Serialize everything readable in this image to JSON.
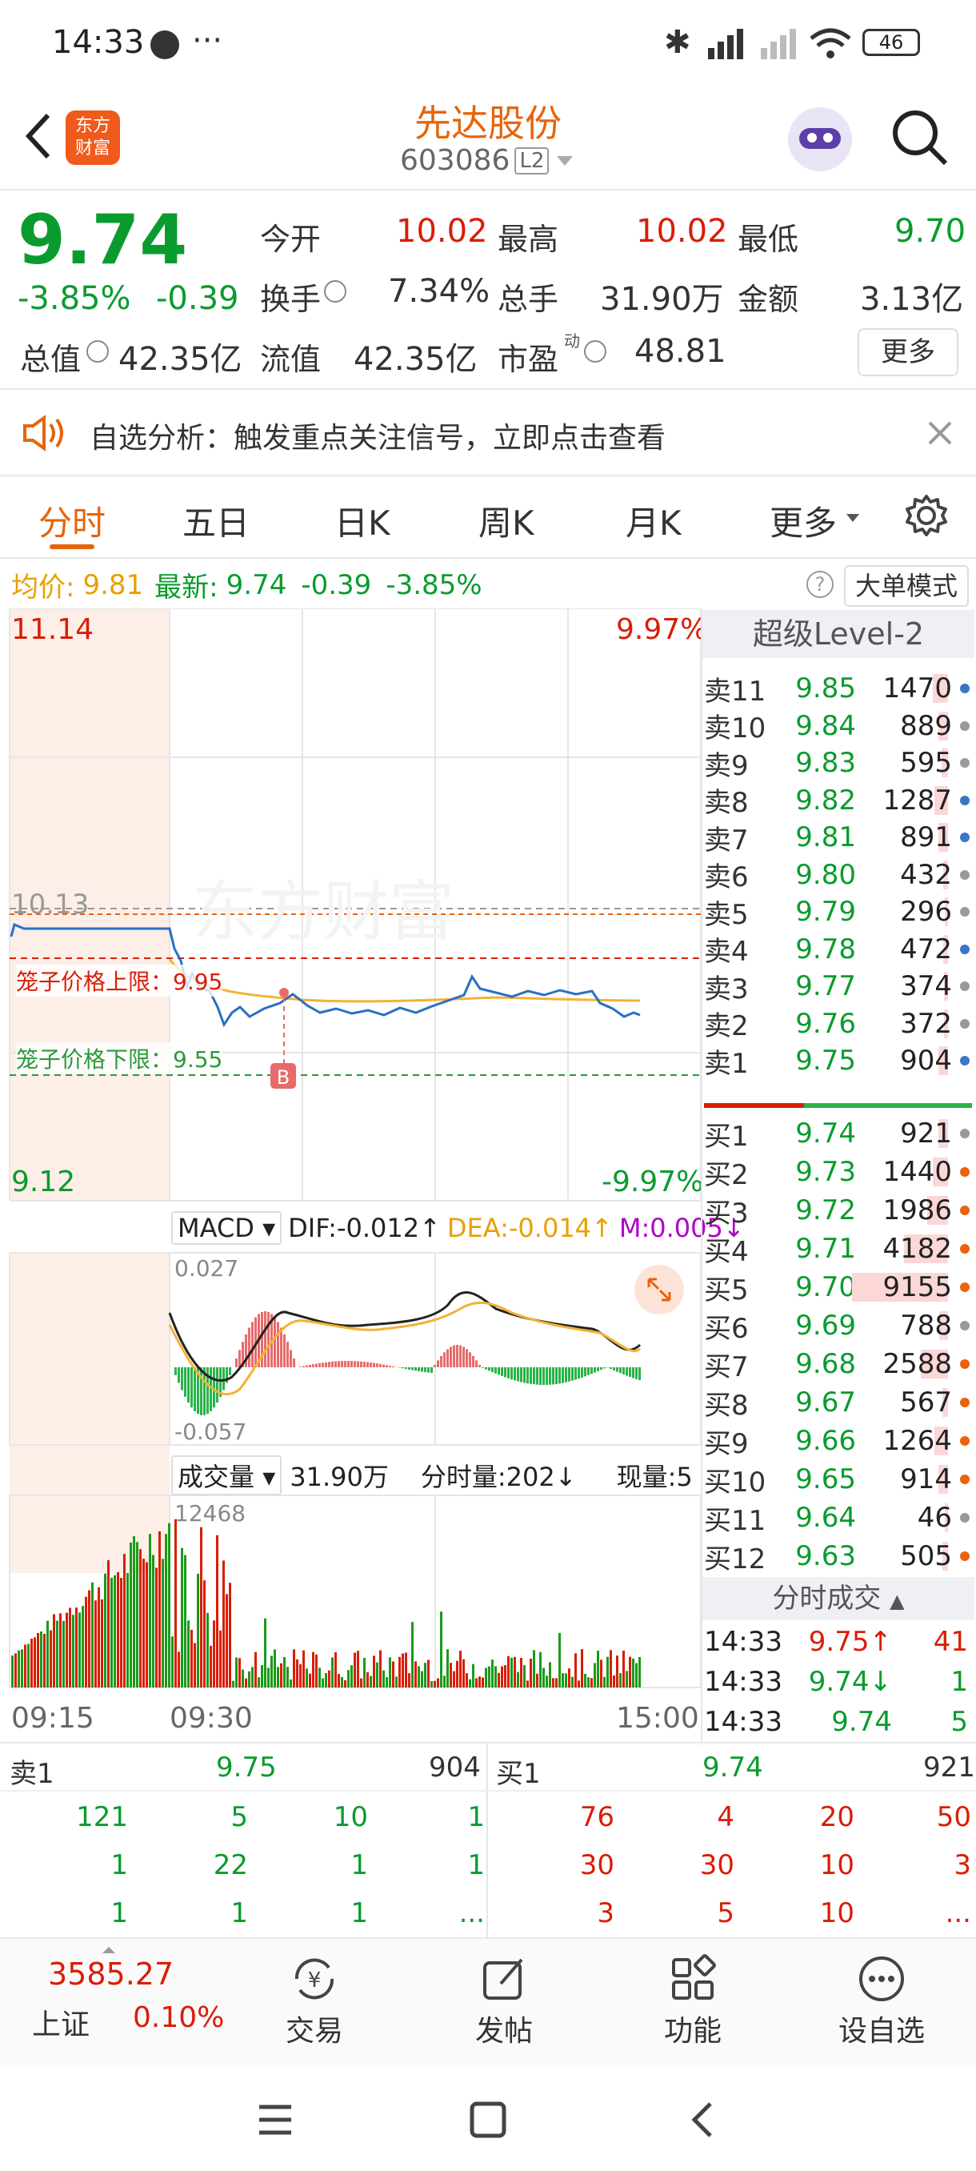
{
  "status_bar": {
    "time": "14:33",
    "more": "···",
    "battery": "46"
  },
  "header": {
    "stock_name": "先达股份",
    "stock_code": "603086",
    "level_badge": "L2",
    "logo_text": "东方财富"
  },
  "quote": {
    "price": "9.74",
    "change_pct": "-3.85%",
    "change": "-0.39",
    "open_label": "今开",
    "open": "10.02",
    "high_label": "最高",
    "high": "10.02",
    "low_label": "最低",
    "low": "9.70",
    "turnover_label": "换手",
    "turnover": "7.34%",
    "volume_label": "总手",
    "volume": "31.90万",
    "amount_label": "金额",
    "amount": "3.13亿",
    "mktcap_label": "总值",
    "mktcap": "42.35亿",
    "float_label": "流值",
    "float_cap": "42.35亿",
    "pe_label": "市盈",
    "pe_sup": "动",
    "pe": "48.81",
    "more_button": "更多"
  },
  "notice": {
    "text": "自选分析：触发重点关注信号，立即点击查看"
  },
  "chart_tabs": [
    "分时",
    "五日",
    "日K",
    "周K",
    "月K",
    "更多"
  ],
  "info_line": {
    "avg_label": "均价:",
    "avg": "9.81",
    "latest_label": "最新:",
    "latest": "9.74",
    "change": "-0.39",
    "change_pct": "-3.85%",
    "mode_button": "大单模式"
  },
  "intraday": {
    "top_price": "11.14",
    "top_pct": "9.97%",
    "bottom_price": "9.12",
    "bottom_pct": "-9.97%",
    "ref_price": "10.13",
    "upper_limit_label": "笼子价格上限：9.95",
    "lower_limit_label": "笼子价格下限：9.55",
    "buy_marker": "B",
    "watermark": "东方财富"
  },
  "macd": {
    "selector": "MACD",
    "dif": "DIF:-0.012↑",
    "dea": "DEA:-0.014↑",
    "m": "M:0.005↓",
    "top": "0.027",
    "bottom": "-0.057"
  },
  "volume_panel": {
    "selector": "成交量",
    "total": "31.90万",
    "period": "分时量:202↓",
    "current": "现量:5",
    "max": "12468"
  },
  "time_axis": [
    "09:15",
    "09:30",
    "15:00"
  ],
  "level2": {
    "title": "超级Level-2",
    "asks": [
      {
        "label": "卖11",
        "price": "9.85",
        "vol": "1470",
        "dot": "#3b76c4",
        "bar": 0.16
      },
      {
        "label": "卖10",
        "price": "9.84",
        "vol": "889",
        "dot": "#999999",
        "bar": 0.1
      },
      {
        "label": "卖9",
        "price": "9.83",
        "vol": "595",
        "dot": "#999999",
        "bar": 0.07
      },
      {
        "label": "卖8",
        "price": "9.82",
        "vol": "1287",
        "dot": "#3b76c4",
        "bar": 0.14
      },
      {
        "label": "卖7",
        "price": "9.81",
        "vol": "891",
        "dot": "#3b76c4",
        "bar": 0.1
      },
      {
        "label": "卖6",
        "price": "9.80",
        "vol": "432",
        "dot": "#999999",
        "bar": 0.05
      },
      {
        "label": "卖5",
        "price": "9.79",
        "vol": "296",
        "dot": "#999999",
        "bar": 0.03
      },
      {
        "label": "卖4",
        "price": "9.78",
        "vol": "472",
        "dot": "#3b76c4",
        "bar": 0.05
      },
      {
        "label": "卖3",
        "price": "9.77",
        "vol": "374",
        "dot": "#999999",
        "bar": 0.04
      },
      {
        "label": "卖2",
        "price": "9.76",
        "vol": "372",
        "dot": "#999999",
        "bar": 0.04
      },
      {
        "label": "卖1",
        "price": "9.75",
        "vol": "904",
        "dot": "#3b76c4",
        "bar": 0.1
      }
    ],
    "bids": [
      {
        "label": "买1",
        "price": "9.74",
        "vol": "921",
        "dot": "#999999",
        "bar": 0.1
      },
      {
        "label": "买2",
        "price": "9.73",
        "vol": "1440",
        "dot": "#e8630a",
        "bar": 0.16
      },
      {
        "label": "买3",
        "price": "9.72",
        "vol": "1986",
        "dot": "#e8630a",
        "bar": 0.22
      },
      {
        "label": "买4",
        "price": "9.71",
        "vol": "4182",
        "dot": "#e8630a",
        "bar": 0.46
      },
      {
        "label": "买5",
        "price": "9.70",
        "vol": "9155",
        "dot": "#e8630a",
        "bar": 1.0
      },
      {
        "label": "买6",
        "price": "9.69",
        "vol": "788",
        "dot": "#999999",
        "bar": 0.09
      },
      {
        "label": "买7",
        "price": "9.68",
        "vol": "2588",
        "dot": "#e8630a",
        "bar": 0.28
      },
      {
        "label": "买8",
        "price": "9.67",
        "vol": "567",
        "dot": "#e8630a",
        "bar": 0.06
      },
      {
        "label": "买9",
        "price": "9.66",
        "vol": "1264",
        "dot": "#e8630a",
        "bar": 0.14
      },
      {
        "label": "买10",
        "price": "9.65",
        "vol": "914",
        "dot": "#e8630a",
        "bar": 0.1
      },
      {
        "label": "买11",
        "price": "9.64",
        "vol": "46",
        "dot": "#999999",
        "bar": 0.01
      },
      {
        "label": "买12",
        "price": "9.63",
        "vol": "505",
        "dot": "#e8630a",
        "bar": 0.06
      }
    ],
    "trades_title": "分时成交",
    "trades": [
      {
        "time": "14:33",
        "price": "9.75↑",
        "vol": "41",
        "color": "#d81e06"
      },
      {
        "time": "14:33",
        "price": "9.74↓",
        "vol": "1",
        "color": "#0a9b2e"
      },
      {
        "time": "14:33",
        "price": "9.74",
        "vol": "5",
        "color": "#0a9b2e"
      }
    ]
  },
  "deal_queue": {
    "ask_label": "卖1",
    "ask_price": "9.75",
    "ask_vol": "904",
    "bid_label": "买1",
    "bid_price": "9.74",
    "bid_vol": "921",
    "ask_rows": [
      [
        "121",
        "5",
        "10",
        "1"
      ],
      [
        "1",
        "22",
        "1",
        "1"
      ],
      [
        "1",
        "1",
        "1",
        "..."
      ]
    ],
    "bid_rows": [
      [
        "76",
        "4",
        "20",
        "50"
      ],
      [
        "30",
        "30",
        "10",
        "3"
      ],
      [
        "3",
        "5",
        "10",
        "..."
      ]
    ]
  },
  "bottom_nav": {
    "index_value": "3585.27",
    "index_name": "上证",
    "index_pct": "0.10%",
    "trade": "交易",
    "post": "发帖",
    "func": "功能",
    "watch": "设自选"
  }
}
